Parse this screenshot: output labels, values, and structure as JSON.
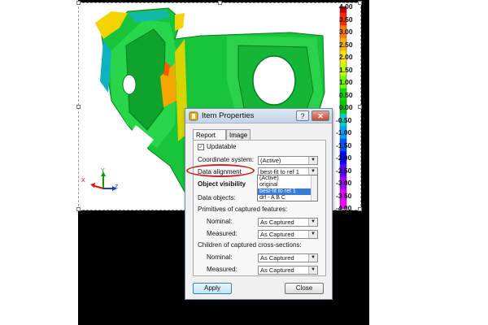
{
  "scale": {
    "labels": [
      "4.00",
      "3.50",
      "3.00",
      "2.50",
      "2.00",
      "1.50",
      "1.00",
      "0.50",
      "0.00",
      "-0.50",
      "-1.00",
      "-1.50",
      "-2.00",
      "-2.50",
      "-3.00",
      "-3.50",
      "-4.00"
    ],
    "colors": [
      "#d10000",
      "#ff2a00",
      "#ff7a00",
      "#ffb300",
      "#ffe500",
      "#c8ff00",
      "#6cff00",
      "#00e000",
      "#00c800",
      "#00d0c8",
      "#00a0ff",
      "#0050ff",
      "#0000ff",
      "#5a00ff",
      "#a000ff",
      "#e000ff",
      "#ff00ff"
    ]
  },
  "axes": {
    "x": "X",
    "y": "Y",
    "z": "Z"
  },
  "dialog": {
    "title": "Item Properties",
    "help_label": "?",
    "close_label": "✕",
    "tabs": [
      "Report item",
      "Image"
    ],
    "updatable_label": "Updatable",
    "updatable_checked": "✓",
    "coordinate_system": {
      "label": "Coordinate system:",
      "value": "(Active)"
    },
    "data_alignment": {
      "label": "Data alignment",
      "value": "best-fit to ref 1"
    },
    "alignment_options": [
      "(Active)",
      "original",
      "best-fit to ref 1",
      "drf - A B C"
    ],
    "object_visibility_label": "Object visibility",
    "data_objects_label": "Data objects:",
    "primitives_section": "Primitives of captured features:",
    "primitives_nominal": {
      "label": "Nominal:",
      "value": "As Captured"
    },
    "primitives_measured": {
      "label": "Measured:",
      "value": "As Captured"
    },
    "children_section": "Children of captured cross-sections:",
    "children_nominal": {
      "label": "Nominal:",
      "value": "As Captured"
    },
    "children_measured": {
      "label": "Measured:",
      "value": "As Captured"
    },
    "apply_label": "Apply",
    "close_button_label": "Close",
    "arrow": "▼"
  },
  "colors": {
    "highlight": "#c62828",
    "selection": "#3a7bd5"
  }
}
